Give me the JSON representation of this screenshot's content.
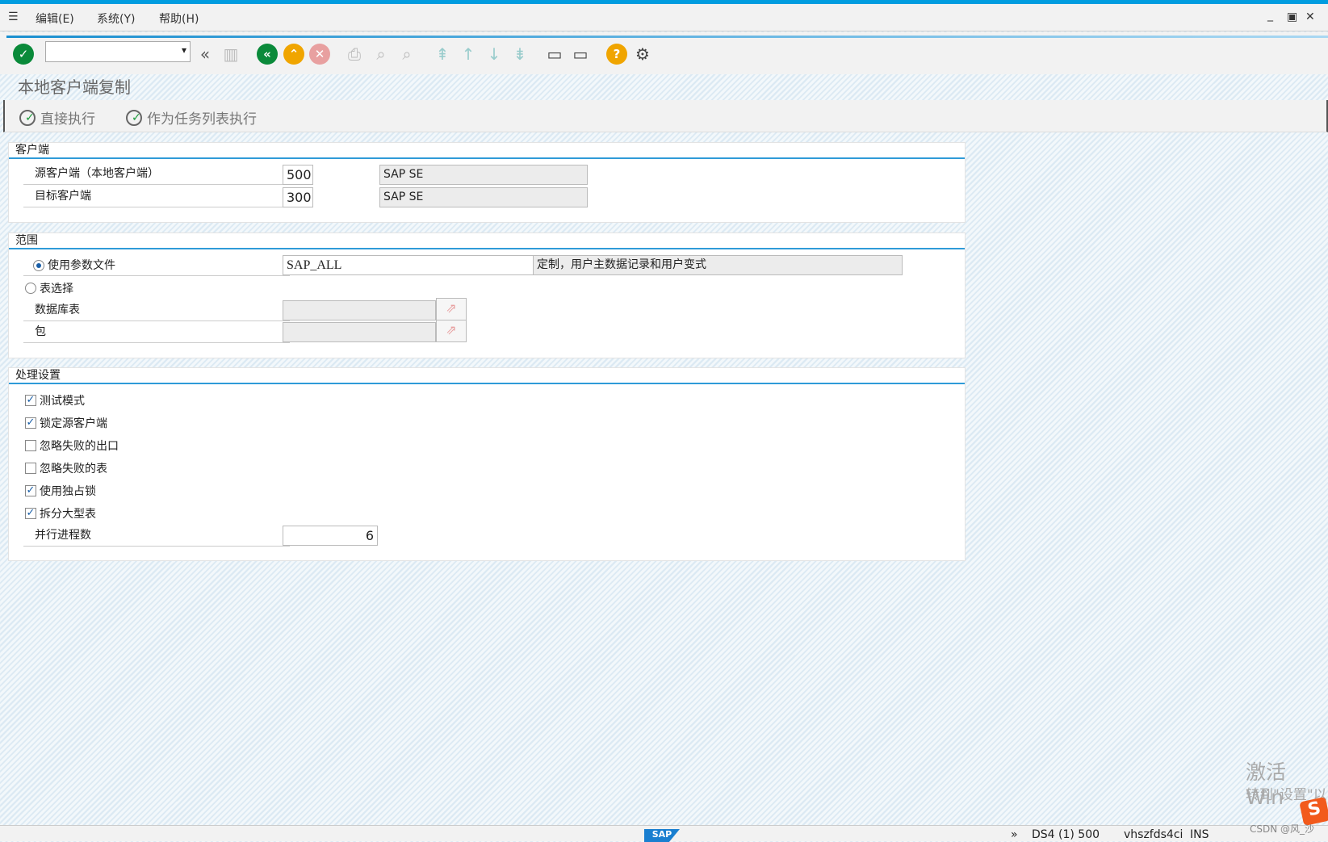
{
  "menu": {
    "items": [
      "编辑(E)",
      "系统(Y)",
      "帮助(H)"
    ]
  },
  "title": "本地客户端复制",
  "appbar": {
    "direct": "直接执行",
    "tasklist": "作为任务列表执行"
  },
  "client": {
    "header": "客户端",
    "source_label": "源客户端（本地客户端）",
    "source_value": "500",
    "source_desc": "SAP SE",
    "target_label": "目标客户端",
    "target_value": "300",
    "target_desc": "SAP SE"
  },
  "scope": {
    "header": "范围",
    "profile_label": "使用参数文件",
    "profile_value": "SAP_ALL",
    "profile_desc": "定制，用户主数据记录和用户变式",
    "table_label": "表选择",
    "dbtable_label": "数据库表",
    "package_label": "包"
  },
  "processing": {
    "header": "处理设置",
    "options": [
      {
        "label": "测试模式",
        "checked": true
      },
      {
        "label": "锁定源客户端",
        "checked": true
      },
      {
        "label": "忽略失败的出口",
        "checked": false
      },
      {
        "label": "忽略失败的表",
        "checked": false
      },
      {
        "label": "使用独占锁",
        "checked": true
      },
      {
        "label": "拆分大型表",
        "checked": true
      }
    ],
    "parallel_label": "并行进程数",
    "parallel_value": "6"
  },
  "status": {
    "more": "»",
    "system": "DS4 (1) 500",
    "server": "vhszfds4ci",
    "mode": "INS"
  },
  "watermark": {
    "line1": "激活 Win",
    "line2": "转到\"设置\"以",
    "csdn": "CSDN @风_沙"
  }
}
